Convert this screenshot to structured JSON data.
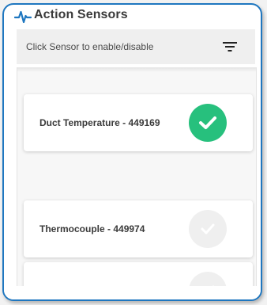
{
  "header": {
    "title": "Action Sensors",
    "icon": "pulse-icon",
    "accent_color": "#1f77c0"
  },
  "filter_bar": {
    "text": "Click Sensor to enable/disable",
    "icon": "filter-icon"
  },
  "sensors": [
    {
      "label": "Duct Temperature - 449169",
      "enabled": true,
      "status_color": "#27c07d"
    },
    {
      "label": "Thermocouple - 449974",
      "enabled": false,
      "status_color": "#efefef"
    },
    {
      "label": "",
      "enabled": false,
      "status_color": "#efefef"
    }
  ]
}
